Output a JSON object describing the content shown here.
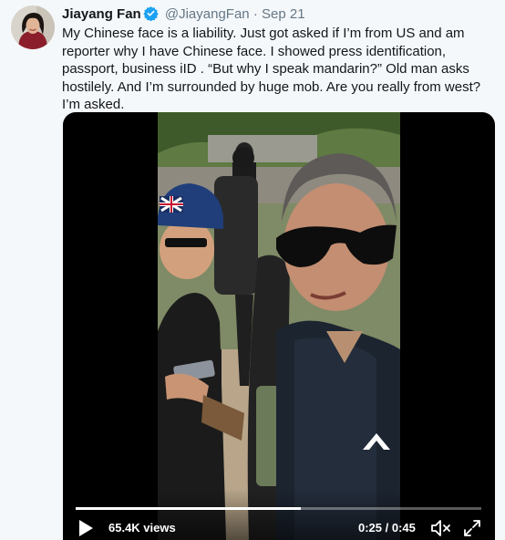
{
  "tweet": {
    "author_name": "Jiayang Fan",
    "verified": true,
    "handle": "@JiayangFan",
    "separator": "·",
    "date": "Sep 21",
    "text": "My Chinese face is a liability. Just got asked if I’m from US and am reporter why I have Chinese face. I showed press identification, passport, business iID . “But why I speak mandarin?” Old man asks hostilely. And I’m surrounded by huge mob. Are you really from west? I’m asked."
  },
  "video": {
    "views": "65.4K views",
    "time": "0:25 / 0:45",
    "progress": 0.556,
    "icons": {
      "play": "play-icon",
      "volume": "volume-icon",
      "fullscreen": "fullscreen-icon"
    }
  },
  "colors": {
    "background": "#f5f8fa",
    "secondary_text": "#657786",
    "verified_blue": "#1da1f2",
    "video_background": "#000000"
  }
}
